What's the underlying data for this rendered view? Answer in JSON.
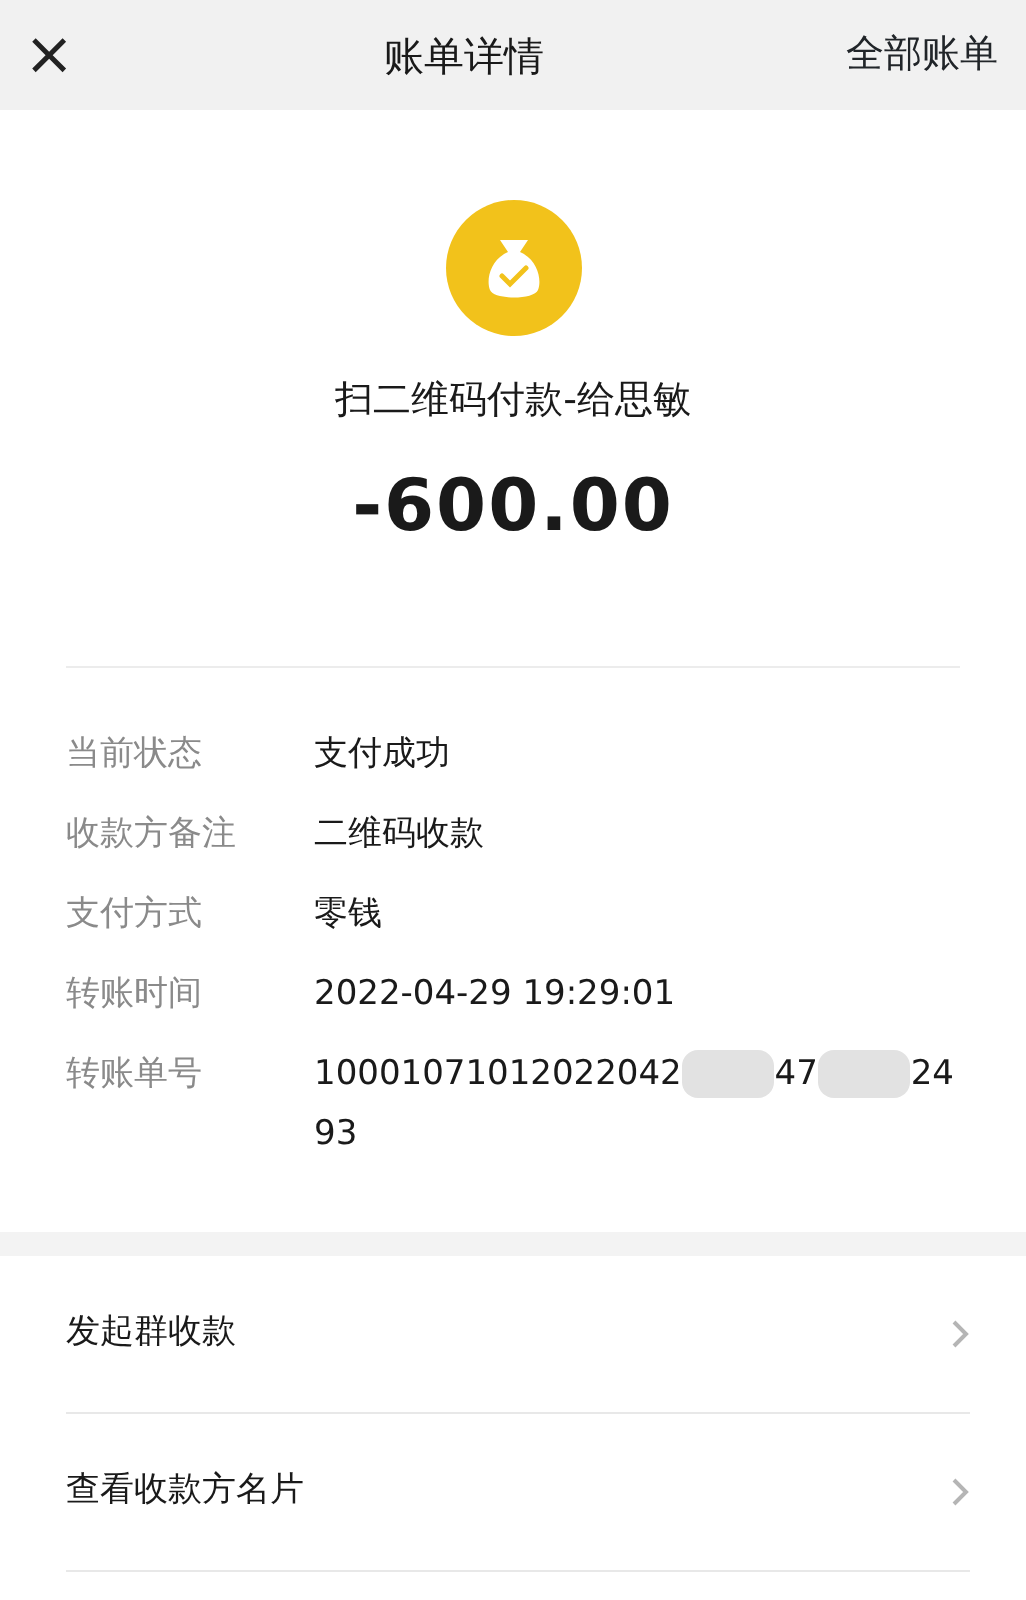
{
  "header": {
    "close": "×",
    "title": "账单详情",
    "action": "全部账单"
  },
  "summary": {
    "title": "扫二维码付款-给思敏",
    "amount": "-600.00"
  },
  "details": [
    {
      "label": "当前状态",
      "value": [
        "支付成功"
      ]
    },
    {
      "label": "收款方备注",
      "value": [
        "二维码收款"
      ]
    },
    {
      "label": "支付方式",
      "value": [
        "零钱"
      ]
    },
    {
      "label": "转账时间",
      "value": [
        "2022-04-29 19:29:01"
      ]
    },
    {
      "label": "转账单号",
      "value": [
        "10001071012022042",
        "47",
        "24"
      ],
      "value_end": "93"
    }
  ],
  "actions": [
    {
      "label": "发起群收款"
    },
    {
      "label": "查看收款方名片"
    }
  ]
}
